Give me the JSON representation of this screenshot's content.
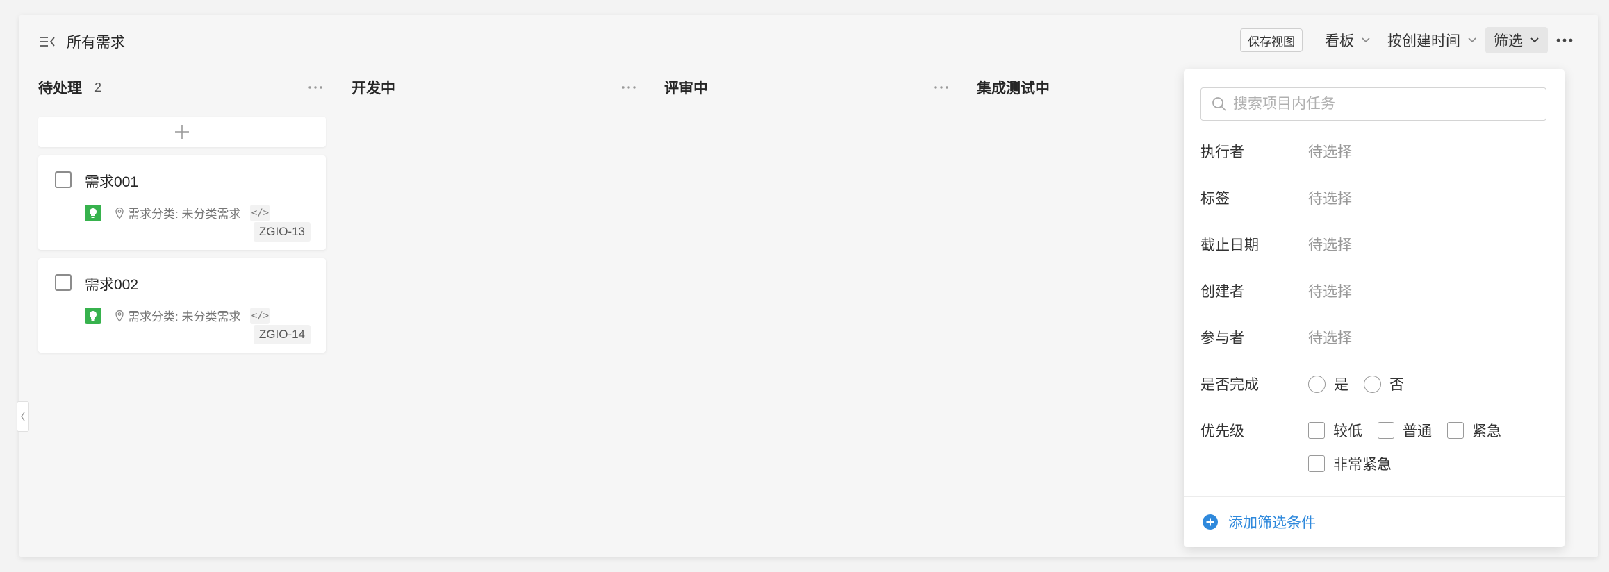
{
  "header": {
    "title": "所有需求",
    "save_view": "保存视图",
    "view_mode": "看板",
    "sort": "按创建时间",
    "filter": "筛选"
  },
  "columns": [
    {
      "name": "待处理",
      "count": "2"
    },
    {
      "name": "开发中",
      "count": ""
    },
    {
      "name": "评审中",
      "count": ""
    },
    {
      "name": "集成测试中",
      "count": ""
    }
  ],
  "cards": [
    {
      "title": "需求001",
      "category": "需求分类: 未分类需求",
      "code": "</>",
      "id": "ZGIO-13"
    },
    {
      "title": "需求002",
      "category": "需求分类: 未分类需求",
      "code": "</>",
      "id": "ZGIO-14"
    }
  ],
  "filter_panel": {
    "search_placeholder": "搜索项目内任务",
    "fields": [
      {
        "label": "执行者",
        "value": "待选择"
      },
      {
        "label": "标签",
        "value": "待选择"
      },
      {
        "label": "截止日期",
        "value": "待选择"
      },
      {
        "label": "创建者",
        "value": "待选择"
      },
      {
        "label": "参与者",
        "value": "待选择"
      }
    ],
    "completed": {
      "label": "是否完成",
      "options": [
        "是",
        "否"
      ]
    },
    "priority": {
      "label": "优先级",
      "options": [
        "较低",
        "普通",
        "紧急",
        "非常紧急"
      ]
    },
    "add_filter": "添加筛选条件"
  },
  "colors": {
    "accent": "#2f89dc",
    "badge": "#37b24d"
  }
}
